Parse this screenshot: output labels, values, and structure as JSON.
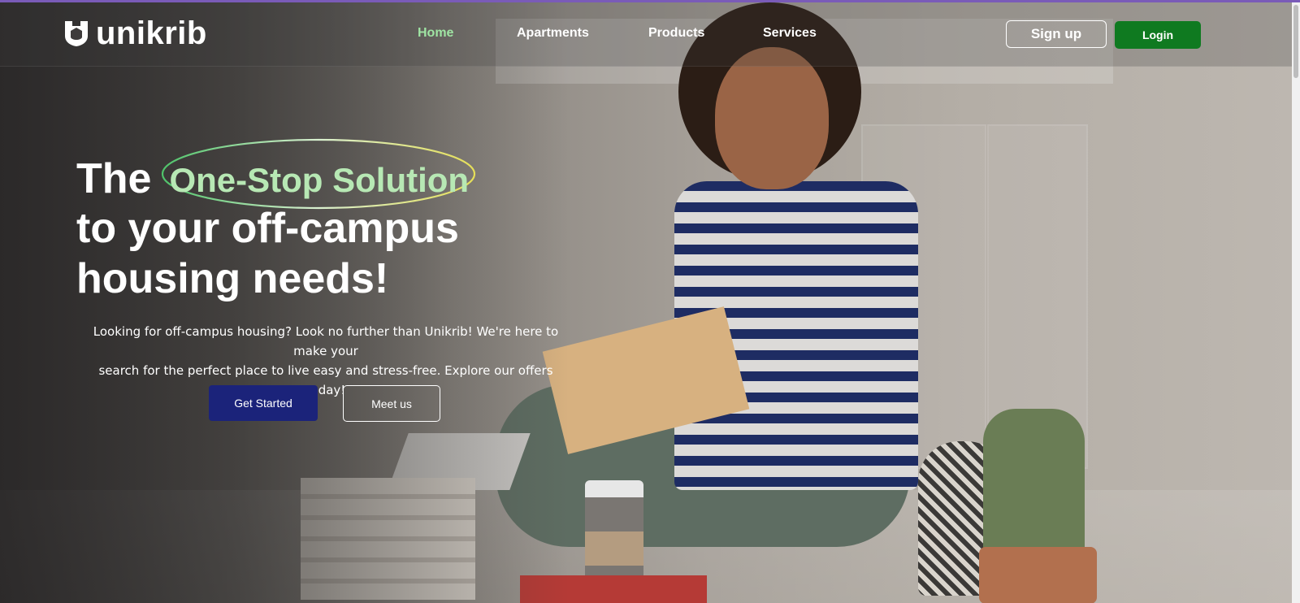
{
  "brand": {
    "name": "unikrib",
    "logo_icon": "unikrib-shield-logo",
    "accent_color": "#0f7a20"
  },
  "nav": {
    "items": [
      {
        "label": "Home",
        "active": true
      },
      {
        "label": "Apartments",
        "active": false
      },
      {
        "label": "Products",
        "active": false
      },
      {
        "label": "Services",
        "active": false
      }
    ],
    "active_color": "#9fe4a3"
  },
  "auth": {
    "signup_label": "Sign up",
    "login_label": "Login"
  },
  "hero": {
    "title_prefix": "The",
    "title_highlight": "One-Stop Solution",
    "title_line2": "to your off-campus",
    "title_line3": "housing needs!",
    "subtitle_line1": "Looking for off-campus housing? Look no further than Unikrib! We're here to make your",
    "subtitle_line2": "search for the perfect place to live easy and stress-free. Explore our offers today!",
    "cta_primary": "Get Started",
    "cta_secondary": "Meet us",
    "primary_color": "#1b237a"
  }
}
